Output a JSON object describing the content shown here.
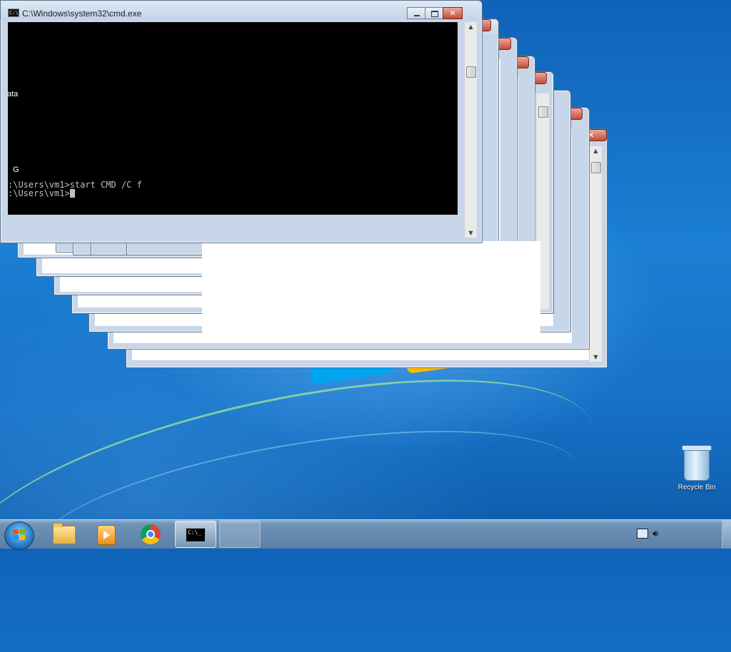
{
  "window_title": "C:\\Windows\\system32\\cmd.exe",
  "terminal": {
    "line1": ":\\Users\\vm1>start CMD /C f",
    "line2": ":\\Users\\vm1>"
  },
  "desktop": {
    "recycle_bin_label": "Recycle Bin",
    "left_edge_fragment_1": "ata",
    "left_edge_fragment_2": "G"
  },
  "taskbar": {
    "start_button": "Start",
    "pinned": [
      "Windows Explorer",
      "Windows Media Player",
      "Google Chrome",
      "Command Prompt"
    ],
    "cmd_icon_text": "C:\\_"
  },
  "icons": {
    "start": "windows-orb-icon",
    "explorer": "folder-icon",
    "media": "media-player-icon",
    "chrome": "chrome-icon",
    "cmd": "cmd-icon",
    "network": "network-icon",
    "volume": "speaker-icon",
    "recycle": "recycle-bin-icon"
  }
}
